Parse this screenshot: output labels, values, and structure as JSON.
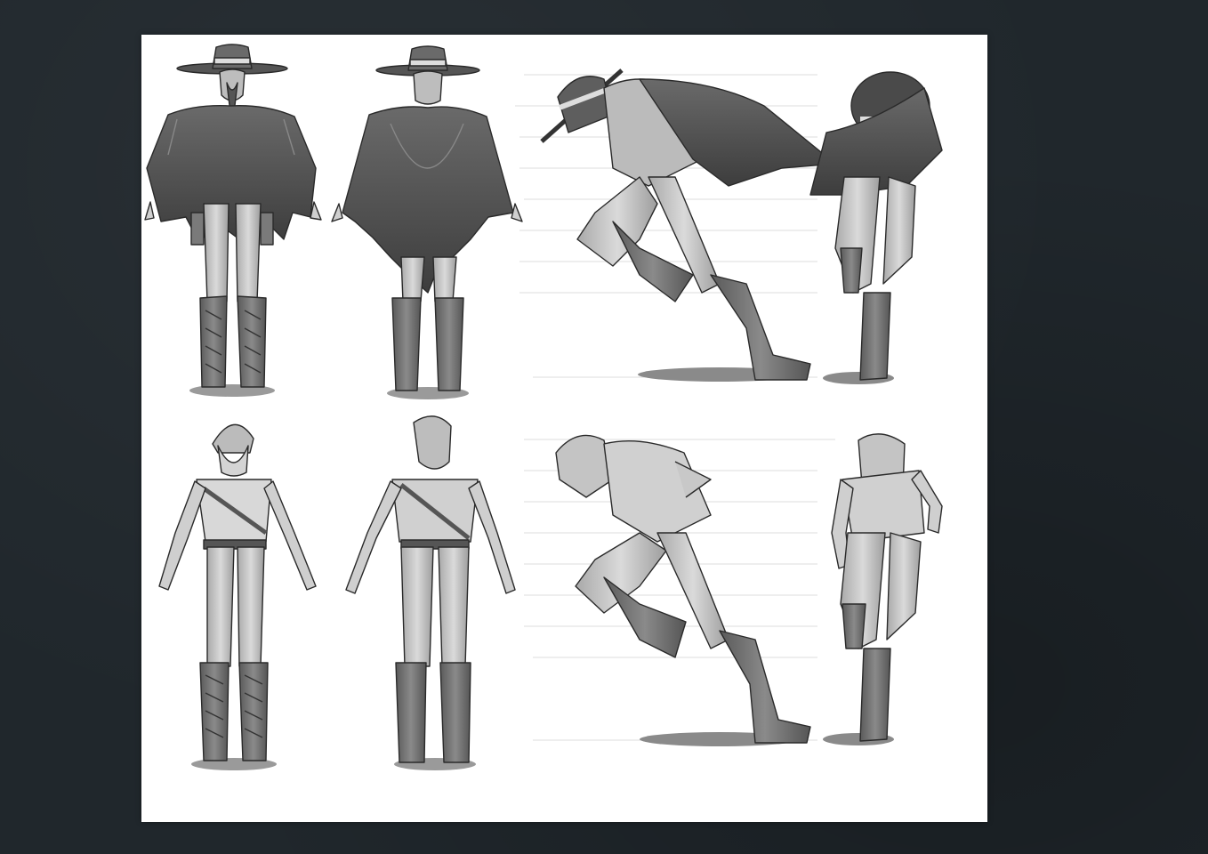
{
  "artwork": {
    "kind": "character-turnaround-sheet",
    "colors": {
      "background": "#20272c",
      "paper": "#ffffff",
      "ink": "#2a2a2a",
      "cloak": "#4a4a4a",
      "skin": "#cfcfcf",
      "pants": "#bdbdbd",
      "boots": "#6b6b6b",
      "shadow": "#9a9a9a",
      "guide_lines": "#d6d6d6"
    },
    "panels": [
      {
        "name": "cloaked-front-view"
      },
      {
        "name": "cloaked-back-view"
      },
      {
        "name": "cloaked-running-side-view"
      },
      {
        "name": "cloaked-running-front-view"
      },
      {
        "name": "uncloaked-front-view"
      },
      {
        "name": "uncloaked-back-view"
      },
      {
        "name": "uncloaked-running-side-view"
      },
      {
        "name": "uncloaked-running-front-view"
      }
    ]
  }
}
